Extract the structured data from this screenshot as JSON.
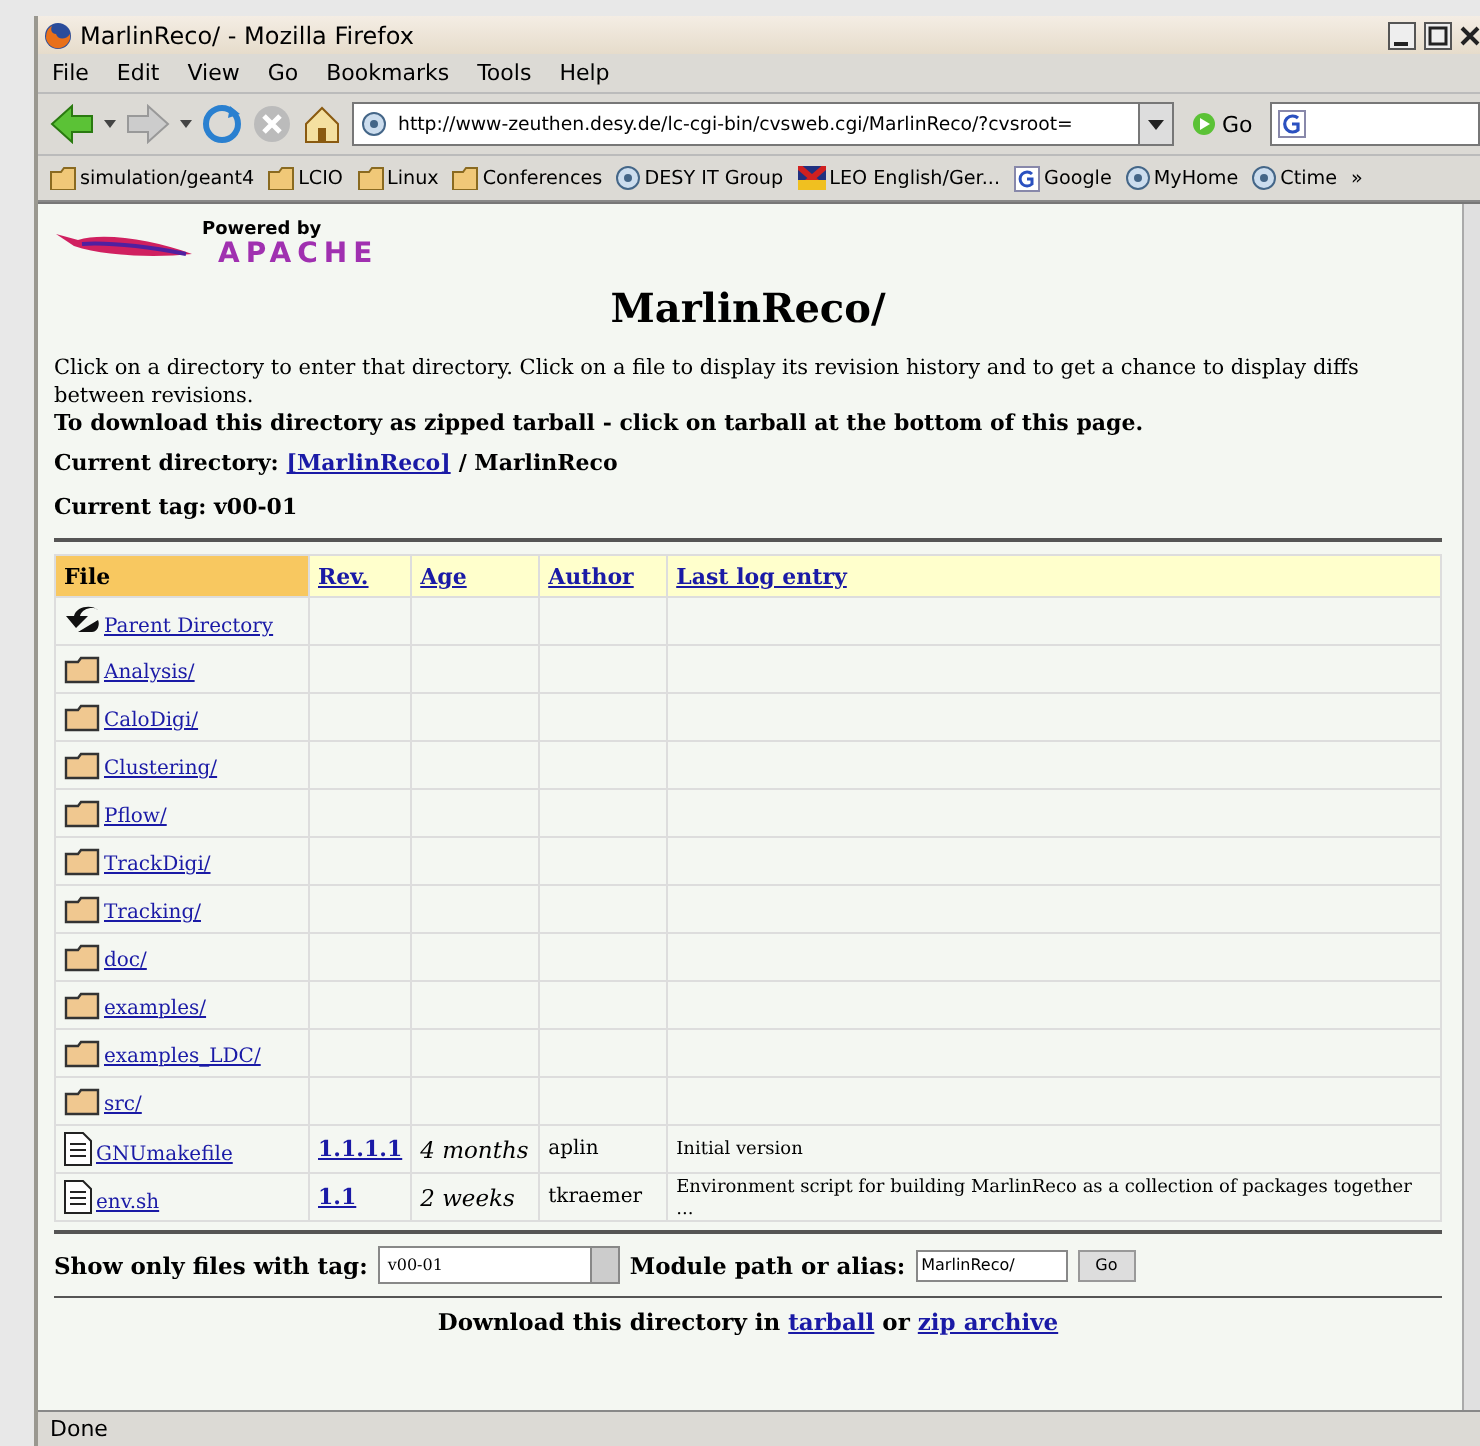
{
  "window": {
    "title": "MarlinReco/ - Mozilla Firefox"
  },
  "menu": [
    "File",
    "Edit",
    "View",
    "Go",
    "Bookmarks",
    "Tools",
    "Help"
  ],
  "address": {
    "value": "http://www-zeuthen.desy.de/lc-cgi-bin/cvsweb.cgi/MarlinReco/?cvsroot=",
    "go": "Go"
  },
  "bookmarks": [
    {
      "label": "simulation/geant4",
      "kind": "folder"
    },
    {
      "label": "LCIO",
      "kind": "folder"
    },
    {
      "label": "Linux",
      "kind": "folder"
    },
    {
      "label": "Conferences",
      "kind": "folder"
    },
    {
      "label": "DESY IT Group",
      "kind": "site"
    },
    {
      "label": "LEO English/Ger...",
      "kind": "flag"
    },
    {
      "label": "Google",
      "kind": "google"
    },
    {
      "label": "MyHome",
      "kind": "site"
    },
    {
      "label": "Ctime",
      "kind": "site"
    },
    {
      "label": "»",
      "kind": "more"
    }
  ],
  "page": {
    "logo_top": "Powered by",
    "logo_bottom": "APACHE",
    "heading": "MarlinReco/",
    "intro": "Click on a directory to enter that directory. Click on a file to display its revision history and to get a chance to display diffs between revisions.",
    "download_note": "To download this directory as zipped tarball - click on tarball at the bottom of this page.",
    "current_directory_label": "Current directory:",
    "current_directory_link": "[MarlinReco]",
    "current_directory_rest": "/ MarlinReco",
    "current_tag": "Current tag: v00-01"
  },
  "table": {
    "columns": [
      {
        "label": "File",
        "sorted": true
      },
      {
        "label": "Rev.",
        "sorted": false
      },
      {
        "label": "Age",
        "sorted": false
      },
      {
        "label": "Author",
        "sorted": false
      },
      {
        "label": "Last log entry",
        "sorted": false
      }
    ],
    "rows": [
      {
        "kind": "parent",
        "name": "Parent Directory"
      },
      {
        "kind": "dir",
        "name": "Analysis/"
      },
      {
        "kind": "dir",
        "name": "CaloDigi/"
      },
      {
        "kind": "dir",
        "name": "Clustering/"
      },
      {
        "kind": "dir",
        "name": "Pflow/"
      },
      {
        "kind": "dir",
        "name": "TrackDigi/"
      },
      {
        "kind": "dir",
        "name": "Tracking/"
      },
      {
        "kind": "dir",
        "name": "doc/"
      },
      {
        "kind": "dir",
        "name": "examples/"
      },
      {
        "kind": "dir",
        "name": "examples_LDC/"
      },
      {
        "kind": "dir",
        "name": "src/"
      },
      {
        "kind": "file",
        "name": "GNUmakefile",
        "rev": "1.1.1.1",
        "age": "4 months",
        "author": "aplin",
        "log": "Initial version"
      },
      {
        "kind": "file",
        "name": "env.sh",
        "rev": "1.1",
        "age": "2 weeks",
        "author": "tkraemer",
        "log": "Environment script for building MarlinReco as a collection of packages together ..."
      }
    ]
  },
  "form": {
    "tag_label": "Show only files with tag:",
    "tag_value": "v00-01",
    "module_label": "Module path or alias:",
    "module_value": "MarlinReco/",
    "go": "Go"
  },
  "download": {
    "before": "Download this directory in",
    "tarball": "tarball",
    "or": "or",
    "zip": "zip archive"
  },
  "status_bar": "Done"
}
